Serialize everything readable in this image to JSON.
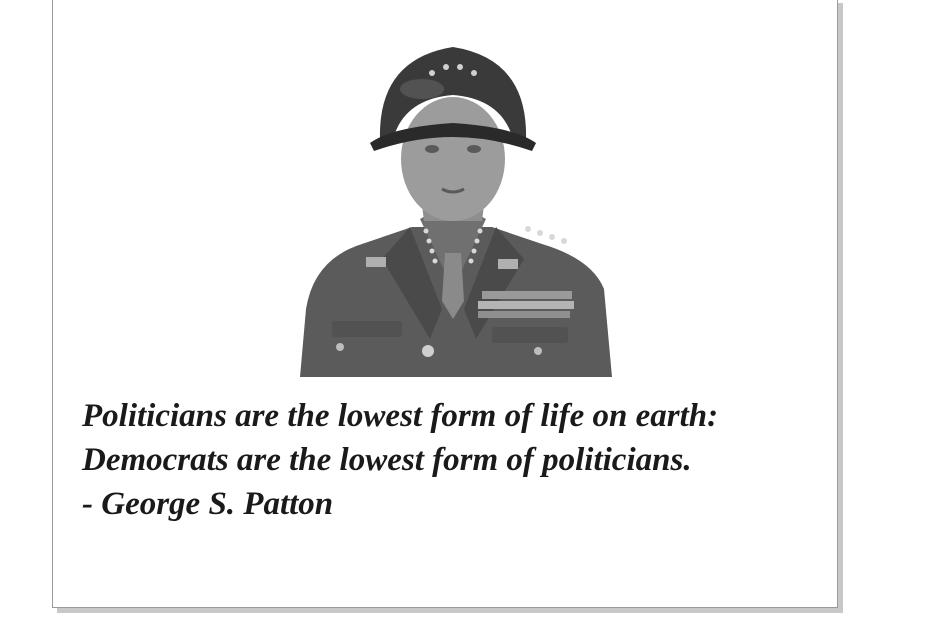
{
  "quote": {
    "line1": "Politicians are the lowest form of life on earth:",
    "line2": "Democrats are the lowest form of politicians.",
    "attribution": "- George S. Patton"
  },
  "portrait": {
    "icon": "general-portrait-image",
    "colors": {
      "uniform": "#5b5b5b",
      "helmet": "#3a3a3a",
      "skin": "#9c9c9c"
    }
  }
}
